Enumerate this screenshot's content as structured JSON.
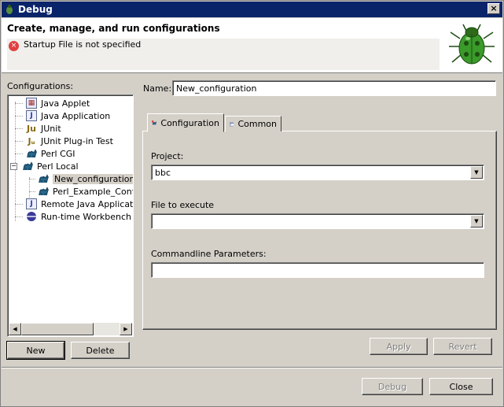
{
  "window": {
    "title": "Debug",
    "close_label": "×"
  },
  "header": {
    "heading": "Create, manage, and run configurations",
    "error_message": "Startup File is not specified",
    "error_icon_glyph": "×"
  },
  "configurations": {
    "label": "Configurations:",
    "items": [
      {
        "label": "Java Applet",
        "icon": "java-applet-icon"
      },
      {
        "label": "Java Application",
        "icon": "java-application-icon"
      },
      {
        "label": "JUnit",
        "icon": "junit-icon"
      },
      {
        "label": "JUnit Plug-in Test",
        "icon": "junit-plugin-icon"
      },
      {
        "label": "Perl CGI",
        "icon": "camel-icon"
      },
      {
        "label": "Perl Local",
        "icon": "camel-icon"
      },
      {
        "label": "New_configuration",
        "icon": "camel-icon",
        "selected": true
      },
      {
        "label": "Perl_Example_Config",
        "icon": "camel-icon"
      },
      {
        "label": "Remote Java Application",
        "icon": "remote-java-icon"
      },
      {
        "label": "Run-time Workbench",
        "icon": "workbench-icon"
      }
    ],
    "expander": "−",
    "scroll_left": "◀",
    "scroll_right": "▶"
  },
  "buttons": {
    "new": "New",
    "delete": "Delete",
    "apply": "Apply",
    "revert": "Revert",
    "debug": "Debug",
    "close": "Close"
  },
  "name_field": {
    "label": "Name:",
    "value": "New_configuration"
  },
  "tabs": [
    {
      "label": "Configuration",
      "active": true
    },
    {
      "label": "Common",
      "active": false
    }
  ],
  "form": {
    "project_label": "Project:",
    "project_value": "bbc",
    "file_label": "File to execute",
    "file_value": "",
    "params_label": "Commandline Parameters:",
    "params_value": "",
    "dropdown_arrow": "▼"
  },
  "colors": {
    "titlebar": "#0a246a",
    "error": "#e04040",
    "bug_green": "#3a9a2a"
  }
}
